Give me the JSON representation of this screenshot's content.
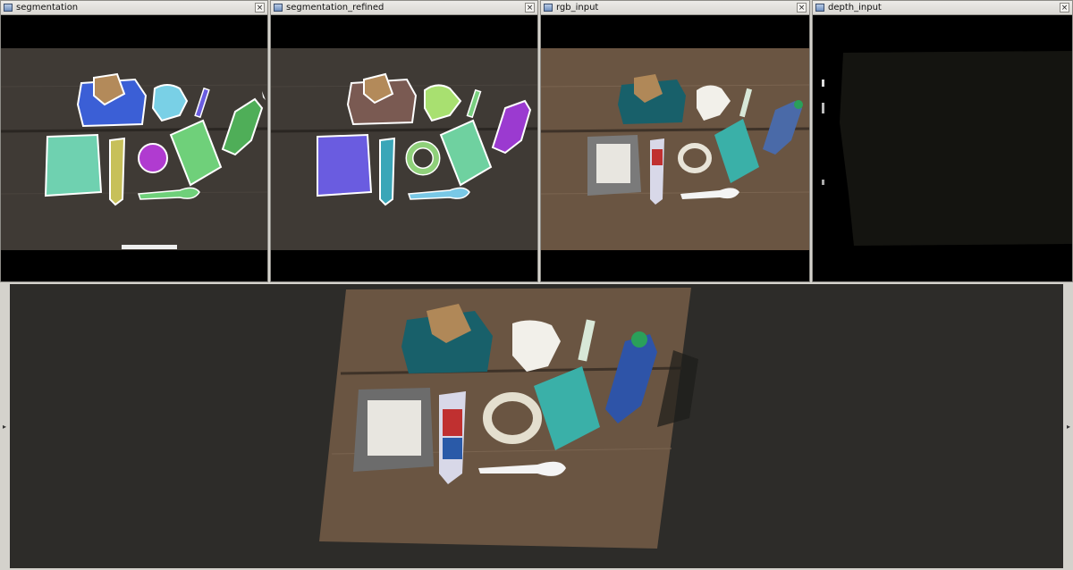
{
  "windows": [
    {
      "title": "segmentation",
      "close_label": "×"
    },
    {
      "title": "segmentation_refined",
      "close_label": "×"
    },
    {
      "title": "rgb_input",
      "close_label": "×"
    },
    {
      "title": "depth_input",
      "close_label": "×"
    }
  ],
  "viewer": {
    "left_arrow": "▸",
    "right_arrow": "▸"
  },
  "colors": {
    "window_bg": "#000000",
    "table_wood": "#5e4a39",
    "viewer_bg": "#2d2c29",
    "mask_blue": "#3b5fd6",
    "mask_cyan": "#79d0e6",
    "mask_green": "#6fd07a",
    "mask_purple": "#b03bd0",
    "mask_teal": "#6fd1b0"
  }
}
